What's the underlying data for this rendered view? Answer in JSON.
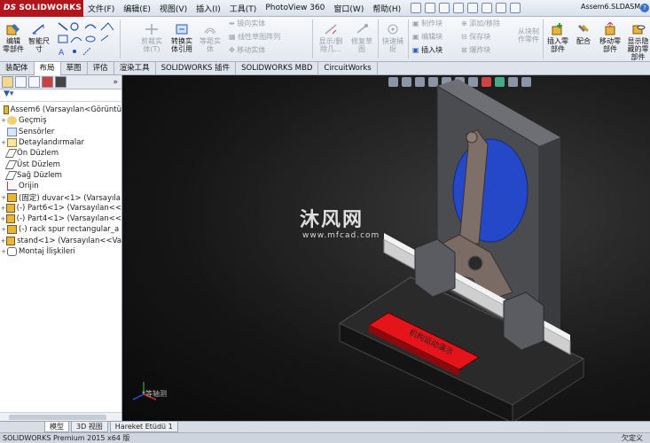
{
  "app": {
    "logo_prefix": "DS",
    "logo": "SOLIDWORKS",
    "document_title": "Assem6.SLDASM *"
  },
  "menu": [
    "文件(F)",
    "编辑(E)",
    "视图(V)",
    "插入(I)",
    "工具(T)",
    "PhotoView 360",
    "窗口(W)",
    "帮助(H)"
  ],
  "ribbon": {
    "edit_component": "编辑\n零部件",
    "smart_dimension": "智能尺\n寸",
    "trim_entities": "剪裁实\n体(T)",
    "convert_entities": "转换实\n体引用",
    "offset_entities": "等距实\n体",
    "mirror_entities": "镜向实体",
    "linear_pattern": "线性草图阵列",
    "move_entities": "移动实体",
    "display_relations": "显示/删\n除几...",
    "repair_sketch": "修复草\n图",
    "quick_snaps": "快速捕\n捉",
    "make_block": "制作块",
    "edit_block": "编辑块",
    "insert_block": "插入块",
    "add_remove": "添加/移除",
    "save_block": "保存块",
    "explode_block": "爆炸块",
    "insert_from_file": "从块制\n作零件",
    "insert_components": "插入零\n部件",
    "mate": "配合",
    "move_component": "移动零\n部件",
    "show_hidden": "显示隐\n藏的零\n部件"
  },
  "tabs": [
    {
      "label": "装配体",
      "active": false
    },
    {
      "label": "布局",
      "active": true
    },
    {
      "label": "草图",
      "active": false
    },
    {
      "label": "评估",
      "active": false
    },
    {
      "label": "渲染工具",
      "active": false
    },
    {
      "label": "SOLIDWORKS 插件",
      "active": false
    },
    {
      "label": "SOLIDWORKS MBD",
      "active": false
    },
    {
      "label": "CircuitWorks",
      "active": false
    }
  ],
  "tree": [
    {
      "label": "Assem6  (Varsayılan<Görüntü",
      "icon": "assembly-icon",
      "exp": ""
    },
    {
      "label": "Geçmiş",
      "icon": "history-icon",
      "exp": "+"
    },
    {
      "label": "Sensörler",
      "icon": "sensor-icon",
      "exp": ""
    },
    {
      "label": "Detaylandırmalar",
      "icon": "annotation-icon",
      "exp": "+"
    },
    {
      "label": "Ön Düzlem",
      "icon": "plane-icon",
      "exp": ""
    },
    {
      "label": "Üst Düzlem",
      "icon": "plane-icon",
      "exp": ""
    },
    {
      "label": "Sağ Düzlem",
      "icon": "plane-icon",
      "exp": ""
    },
    {
      "label": "Orijin",
      "icon": "origin-icon",
      "exp": ""
    },
    {
      "label": "(固定) duvar<1> (Varsayıla",
      "icon": "part-icon",
      "exp": "+"
    },
    {
      "label": "(-) Part6<1> (Varsayılan<<",
      "icon": "part-icon",
      "exp": "+"
    },
    {
      "label": "(-) Part4<1> (Varsayılan<<",
      "icon": "part-icon",
      "exp": "+"
    },
    {
      "label": "(-) rack spur rectangular_a",
      "icon": "part-icon",
      "exp": "+"
    },
    {
      "label": "stand<1> (Varsayılan<<Va",
      "icon": "part-icon",
      "exp": "+"
    },
    {
      "label": "Montaj İlişkileri",
      "icon": "mates-icon",
      "exp": "+"
    }
  ],
  "viewport": {
    "view_label": "*等轴测",
    "watermark": "沐风网",
    "watermark_url": "www.mfcad.com",
    "plate_text": "机构运动演示"
  },
  "bottom_tabs": [
    {
      "label": "模型",
      "active": true
    },
    {
      "label": "3D 视图",
      "active": false
    },
    {
      "label": "Hareket Etüdü 1",
      "active": false
    }
  ],
  "status": {
    "left": "SOLIDWORKS Premium 2015 x64 版",
    "right": "欠定义"
  }
}
